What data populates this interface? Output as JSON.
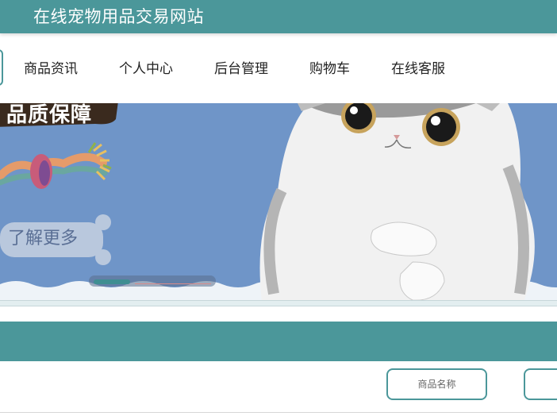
{
  "header": {
    "title": "在线宠物用品交易网站"
  },
  "nav": {
    "items": [
      {
        "label": "商品资讯"
      },
      {
        "label": "个人中心"
      },
      {
        "label": "后台管理"
      },
      {
        "label": "购物车"
      },
      {
        "label": "在线客服"
      }
    ]
  },
  "banner": {
    "tag_text": "品质保障",
    "cta_label": "了解更多",
    "slide_count": 1
  },
  "filter": {
    "product_name_label": "商品名称",
    "second_button_label": ""
  },
  "colors": {
    "primary": "#4b979a",
    "banner_bg": "#6f95c8",
    "white": "#ffffff"
  }
}
